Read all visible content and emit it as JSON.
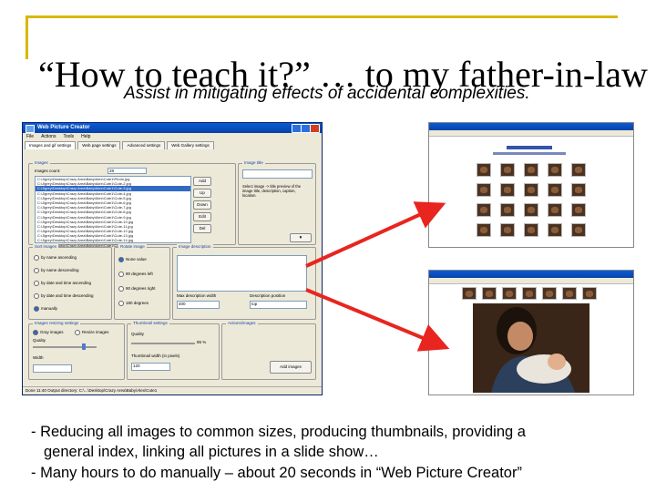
{
  "slide": {
    "title": "“How to teach it?” … to my father-in-law",
    "subtitle": "Assist in mitigating effects of accidental complexities.",
    "bullets": [
      "- Reducing all images to common sizes, producing thumbnails, providing a",
      "general index, linking all pictures in a slide show…",
      "- Many hours to do manually – about 20 seconds in “Web Picture Creator”"
    ]
  },
  "colors": {
    "accent": "#d8b700",
    "arrow": "#e8251f",
    "titlebar": "#0a5bd6"
  },
  "app": {
    "title": "Web Picture Creator",
    "menu": [
      "File",
      "Actions",
      "Tools",
      "Help"
    ],
    "tabs": [
      "Images and gif settings",
      "Web page settings",
      "Advanced settings",
      "Web Gallery settings"
    ],
    "images_label": "Images",
    "images_count_label": "Images count:",
    "images_count": "28",
    "file_list": [
      "C:\\Jlgrey\\Desktop\\Crazy Area\\Baby\\Alex\\Cute1\\Photo.jpg",
      "C:\\Jlgrey\\Desktop\\Crazy Area\\Baby\\Alex\\Cute1\\Cute-2.jpg",
      "C:\\Jlgrey\\Desktop\\Crazy Area\\Baby\\Alex\\Cute1\\Cute-3.jpg",
      "C:\\Jlgrey\\Desktop\\Crazy Area\\Baby\\Alex\\Cute1\\Cute-4.jpg",
      "C:\\Jlgrey\\Desktop\\Crazy Area\\Baby\\Alex\\Cute1\\Cute-5.jpg",
      "C:\\Jlgrey\\Desktop\\Crazy Area\\Baby\\Alex\\Cute1\\Cute-6.jpg",
      "C:\\Jlgrey\\Desktop\\Crazy Area\\Baby\\Alex\\Cute1\\Cute-7.jpg",
      "C:\\Jlgrey\\Desktop\\Crazy Area\\Baby\\Alex\\Cute1\\Cute-8.jpg",
      "C:\\Jlgrey\\Desktop\\Crazy Area\\Baby\\Alex\\Cute1\\Cute-9.jpg",
      "C:\\Jlgrey\\Desktop\\Crazy Area\\Baby\\Alex\\Cute1\\Cute-10.jpg",
      "C:\\Jlgrey\\Desktop\\Crazy Area\\Baby\\Alex\\Cute1\\Cute-11.jpg",
      "C:\\Jlgrey\\Desktop\\Crazy Area\\Baby\\Alex\\Cute1\\Cute-12.jpg",
      "C:\\Jlgrey\\Desktop\\Crazy Area\\Baby\\Alex\\Cute1\\Cute-13.jpg",
      "C:\\Jlgrey\\Desktop\\Crazy Area\\Baby\\Alex\\Cute1\\Cute-14.jpg",
      "C:\\Jlgrey\\Desktop\\Crazy Area\\Baby\\Alex\\Cute1\\Cute-15.jpg"
    ],
    "side_buttons": [
      "Add",
      "Up",
      "Down",
      "Edit",
      "Del"
    ],
    "image_title_label": "Image title",
    "hint_text": "Select image -> title preview of the image title, description, caption, location.",
    "sort_label": "Sort images",
    "sort_options": [
      "by name ascending",
      "by name descending",
      "by date and time ascending",
      "by date and time descending",
      "manually"
    ],
    "rotate_label": "Rotate image",
    "rotate_options": [
      "None value",
      "90 degrees left",
      "90 degrees right",
      "180 degrees"
    ],
    "desc_label": "Image description",
    "max_desc_label": "Max description width",
    "max_desc_value": "400",
    "desc_position_label": "Description position",
    "desc_position_value": "top",
    "resize_label": "Images resizing settings",
    "resize_options": [
      "Gray images",
      "Resize images"
    ],
    "quality_label": "Quality",
    "quality_percent": "85 %",
    "thumbs_label": "Thumbnail settings",
    "thumb_quality_label": "Quality",
    "thumb_width_label": "Thumbnail width (in pixels)",
    "thumb_width_value": "120",
    "actions_label": "Actions/images",
    "add_images_button": "Add images",
    "status_text": "Done     11:40  Output directory:  C:\\...\\Desktop\\Crazy Area\\Baby\\Alex\\Cute1"
  }
}
